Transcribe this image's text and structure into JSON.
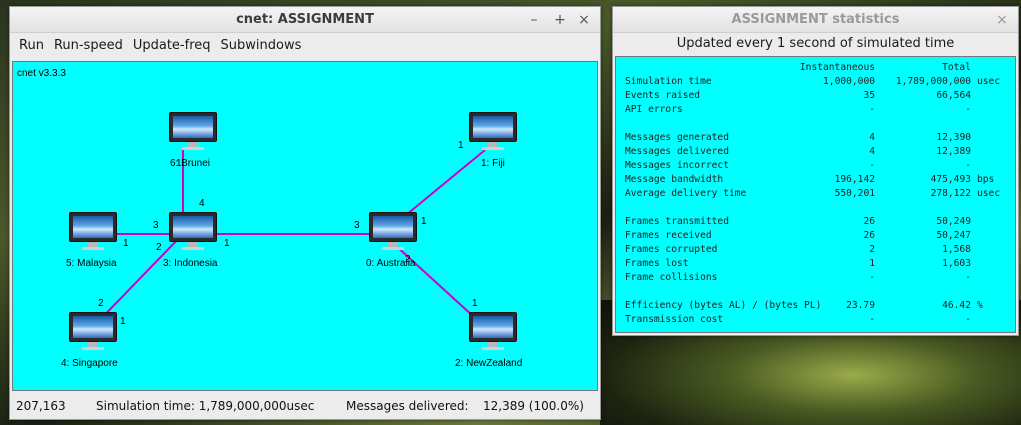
{
  "cnet_window": {
    "title": "cnet: ASSIGNMENT",
    "controls": [
      "–",
      "+",
      "×"
    ],
    "menu": [
      "Run",
      "Run-speed",
      "Update-freq",
      "Subwindows"
    ],
    "version": "cnet v3.3.3",
    "nodes": [
      {
        "label": "6: Brunei"
      },
      {
        "label": "1: Fiji"
      },
      {
        "label": "5: Malaysia"
      },
      {
        "label": "3: Indonesia"
      },
      {
        "label": "0: Australia"
      },
      {
        "label": "4: Singapore"
      },
      {
        "label": "2: NewZealand"
      }
    ],
    "ports": [
      "1",
      "4",
      "1",
      "3",
      "3",
      "1",
      "2",
      "1",
      "1",
      "2",
      "2",
      "1",
      "1"
    ],
    "link_color": "#cc00cc",
    "status": {
      "events": "207,163",
      "sim_time": "Simulation time: 1,789,000,000usec",
      "messages_label": "Messages delivered:",
      "messages_value": "12,389 (100.0%)"
    }
  },
  "stats_window": {
    "title": "ASSIGNMENT statistics",
    "controls": [
      "×"
    ],
    "header": "Updated every 1 second of simulated time",
    "col_instantaneous": "Instantaneous",
    "col_total": "Total",
    "rows": [
      {
        "label": "Simulation time",
        "inst": "1,000,000",
        "total": "1,789,000,000",
        "unit": "usec"
      },
      {
        "label": "Events raised",
        "inst": "35",
        "total": "66,564",
        "unit": ""
      },
      {
        "label": "API errors",
        "inst": "-",
        "total": "-",
        "unit": ""
      },
      {
        "label": "Messages generated",
        "inst": "4",
        "total": "12,390",
        "unit": ""
      },
      {
        "label": "Messages delivered",
        "inst": "4",
        "total": "12,389",
        "unit": ""
      },
      {
        "label": "Messages incorrect",
        "inst": "-",
        "total": "-",
        "unit": ""
      },
      {
        "label": "Message bandwidth",
        "inst": "196,142",
        "total": "475,493",
        "unit": "bps"
      },
      {
        "label": "Average delivery time",
        "inst": "550,201",
        "total": "278,122",
        "unit": "usec"
      },
      {
        "label": "Frames transmitted",
        "inst": "26",
        "total": "50,249",
        "unit": ""
      },
      {
        "label": "Frames received",
        "inst": "26",
        "total": "50,247",
        "unit": ""
      },
      {
        "label": "Frames corrupted",
        "inst": "2",
        "total": "1,568",
        "unit": ""
      },
      {
        "label": "Frames lost",
        "inst": "1",
        "total": "1,603",
        "unit": ""
      },
      {
        "label": "Frame collisions",
        "inst": "-",
        "total": "-",
        "unit": ""
      },
      {
        "label": "Efficiency (bytes AL) / (bytes PL)",
        "inst": "23.79",
        "total": "46.42",
        "unit": "%"
      },
      {
        "label": "Transmission cost",
        "inst": "-",
        "total": "-",
        "unit": ""
      }
    ],
    "background_color": "#00ffff"
  }
}
